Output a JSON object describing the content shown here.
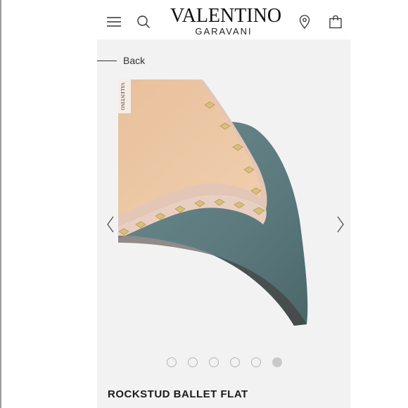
{
  "brand": {
    "name": "VALENTINO",
    "sub": "GARAVANI"
  },
  "header": {
    "menu_icon": "hamburger-menu-icon",
    "search_icon": "search-icon",
    "location_icon": "location-pin-icon",
    "bag_icon": "shopping-bag-icon"
  },
  "nav": {
    "back_label": "Back"
  },
  "gallery": {
    "total": 6,
    "active_index": 5,
    "prev_icon": "chevron-left-icon",
    "next_icon": "chevron-right-icon",
    "image_text": "VALENTINO"
  },
  "product": {
    "title": "ROCKSTUD BALLET FLAT"
  },
  "colors": {
    "leather": "#5f7e82",
    "trim": "#e6c8b8",
    "stud": "#d8bf7e",
    "inner": "#edc7a5",
    "panel": "#f2f2f3"
  }
}
